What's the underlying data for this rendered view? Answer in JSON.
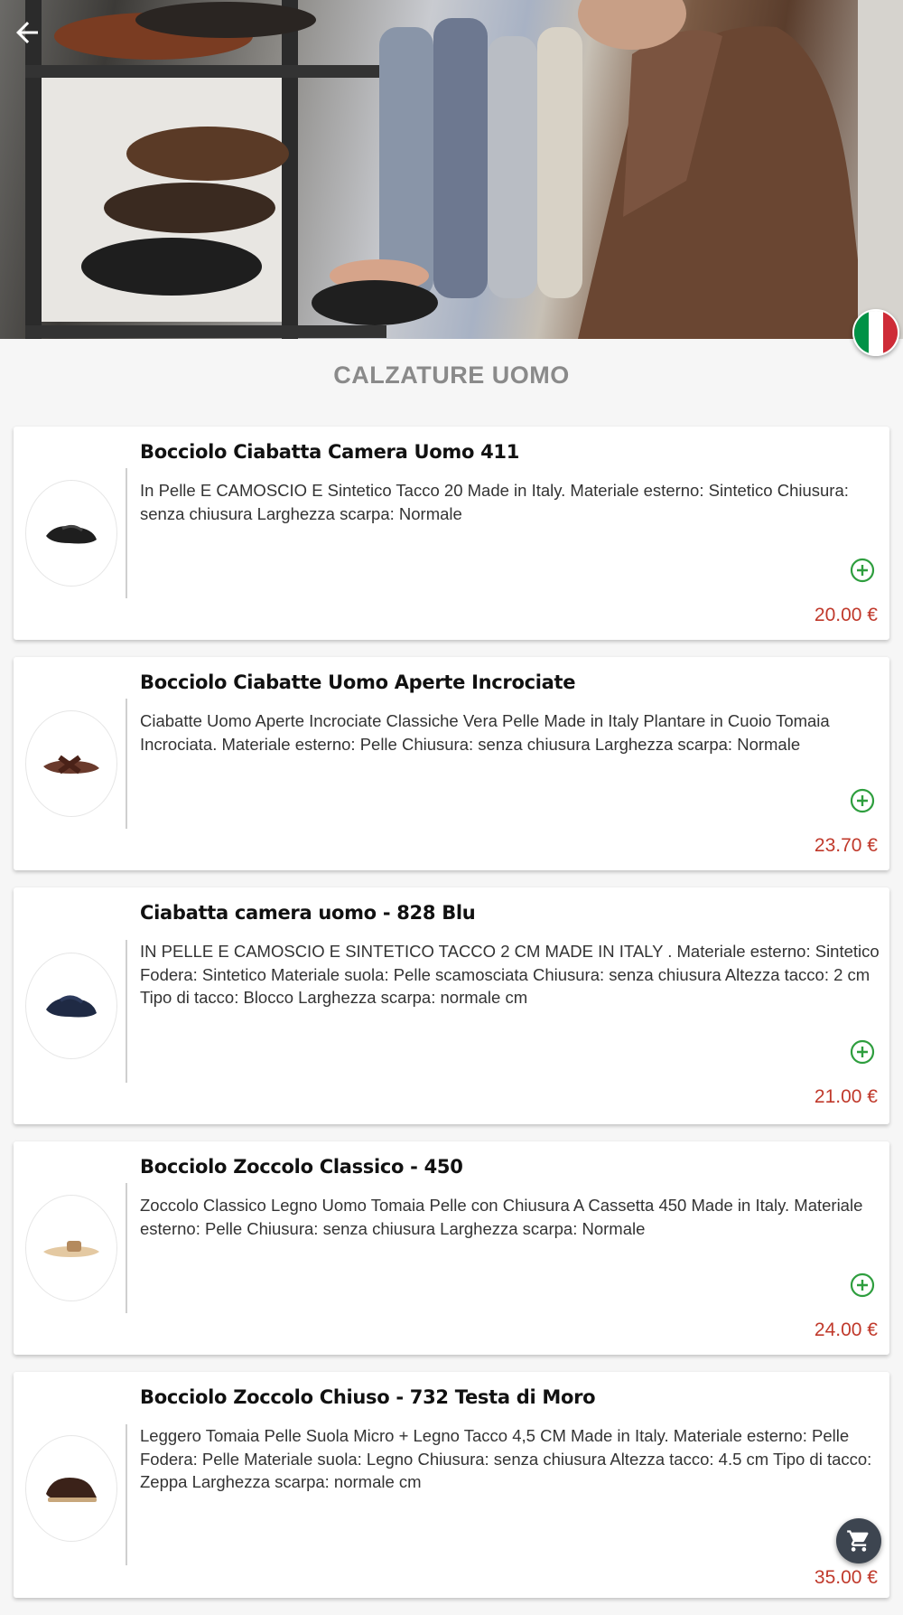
{
  "header": {
    "back_icon": "arrow-left-icon",
    "flag_icon": "italy-flag-icon",
    "flag_colors": [
      "#009246",
      "#ffffff",
      "#ce2b37"
    ]
  },
  "page": {
    "title": "CALZATURE UOMO"
  },
  "products": [
    {
      "name": "Bocciolo Ciabatta Camera Uomo 411",
      "description": "In Pelle E CAMOSCIO E Sintetico Tacco 20 Made in Italy. Materiale esterno: Sintetico Chiusura: senza chiusura Larghezza scarpa: Normale",
      "price": "20.00 €",
      "shoe_color": "#1e1e1e"
    },
    {
      "name": "Bocciolo Ciabatte Uomo Aperte Incrociate",
      "description": "Ciabatte Uomo Aperte Incrociate Classiche Vera Pelle Made in Italy Plantare in Cuoio Tomaia Incrociata. Materiale esterno: Pelle Chiusura: senza chiusura Larghezza scarpa: Normale",
      "price": "23.70 €",
      "shoe_color": "#5a2d22"
    },
    {
      "name": "Ciabatta camera uomo - 828 Blu",
      "description": "IN PELLE E CAMOSCIO E SINTETICO TACCO 2 CM MADE IN ITALY . Materiale esterno: Sintetico Fodera: Sintetico Materiale suola: Pelle scamosciata Chiusura: senza chiusura Altezza tacco: 2 cm Tipo di tacco: Blocco Larghezza scarpa: normale cm",
      "price": "21.00 €",
      "shoe_color": "#1f2a44"
    },
    {
      "name": "Bocciolo Zoccolo Classico - 450",
      "description": "Zoccolo Classico Legno Uomo Tomaia Pelle con Chiusura A Cassetta 450 Made in Italy. Materiale esterno: Pelle Chiusura: senza chiusura Larghezza scarpa: Normale",
      "price": "24.00 €",
      "shoe_color": "#d9b98e"
    },
    {
      "name": "Bocciolo Zoccolo Chiuso - 732 Testa di Moro",
      "description": "Leggero Tomaia Pelle Suola Micro + Legno Tacco 4,5 CM Made in Italy. Materiale esterno: Pelle Fodera: Pelle Materiale suola: Legno Chiusura: senza chiusura Altezza tacco: 4.5 cm Tipo di tacco: Zeppa Larghezza scarpa: normale cm",
      "price": "35.00 €",
      "shoe_color": "#3b2219"
    }
  ],
  "colors": {
    "accent_green": "#2e9e3e",
    "price_red": "#c0392b",
    "fab_bg": "#3d4550"
  },
  "cart": {
    "icon": "shopping-cart-icon"
  }
}
